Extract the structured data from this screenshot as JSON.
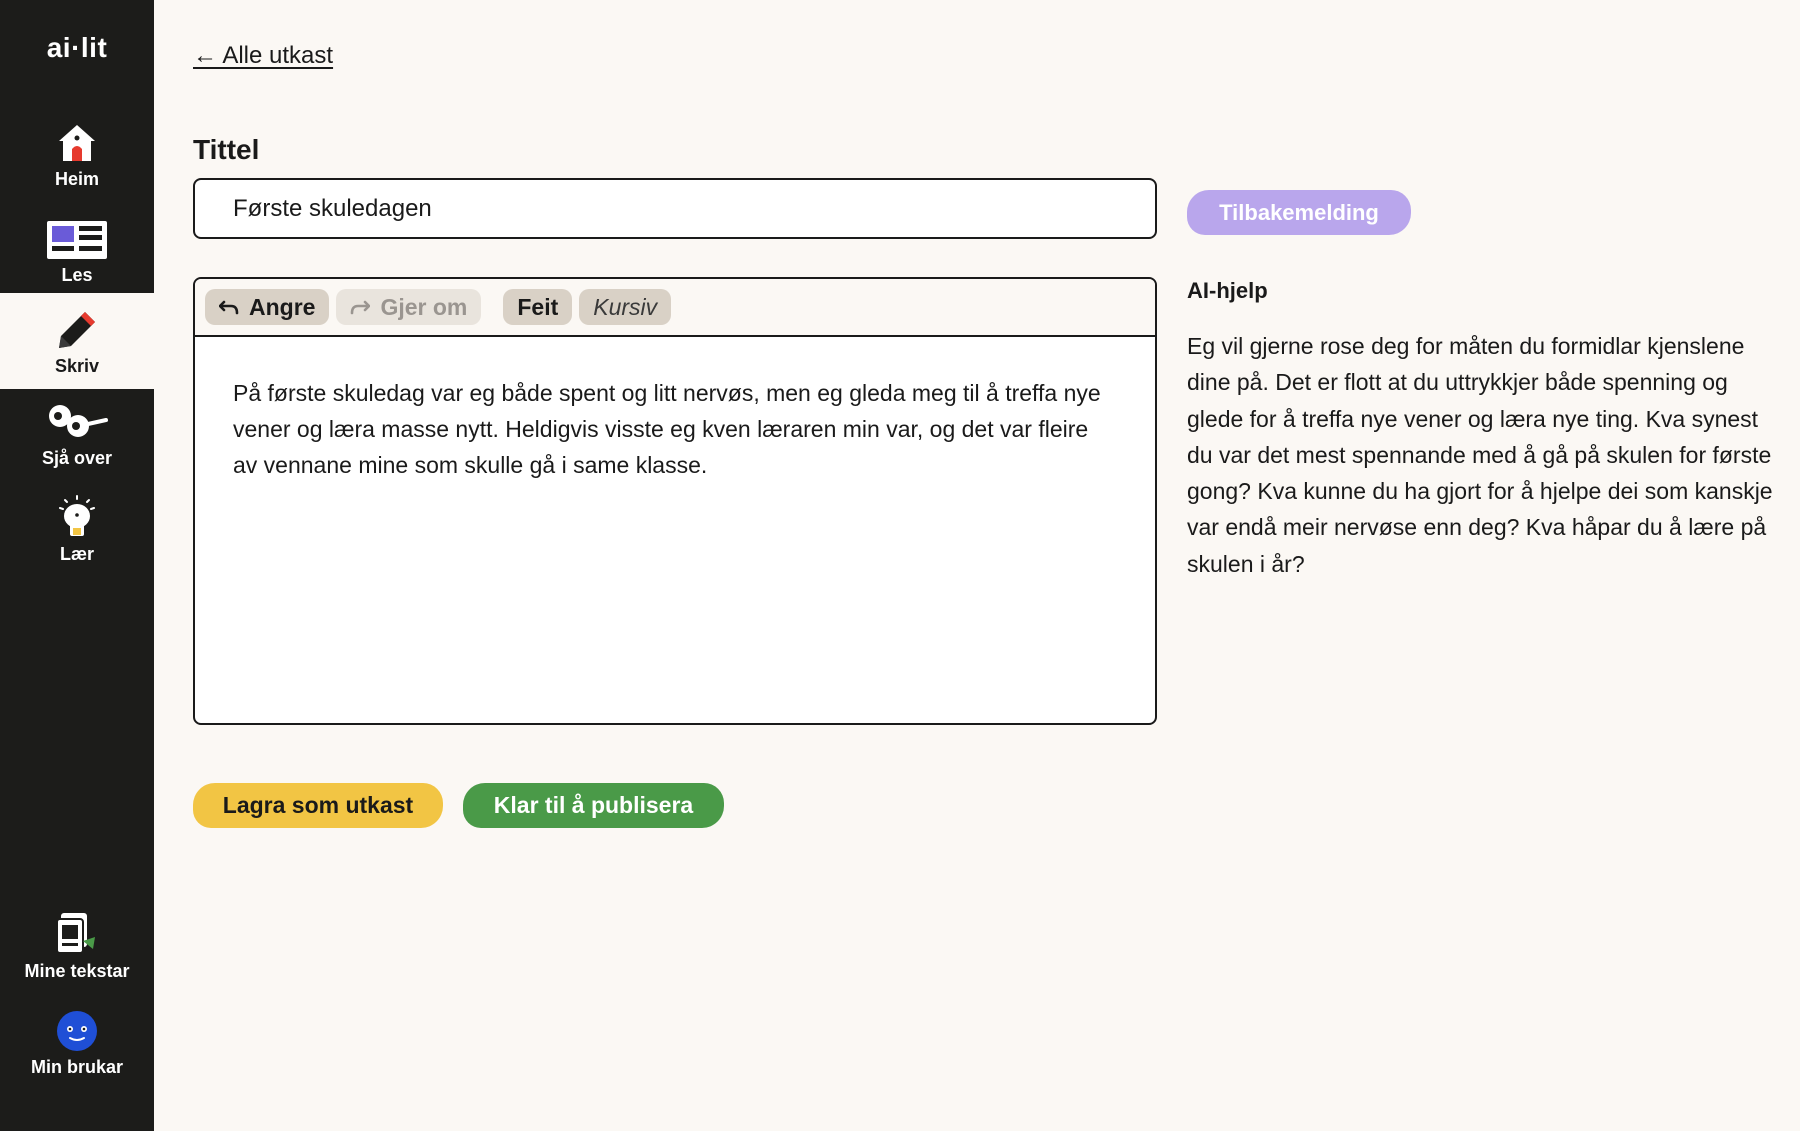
{
  "sidebar": {
    "logo": "ai·lit",
    "items": [
      {
        "label": "Heim",
        "icon": "house-icon"
      },
      {
        "label": "Les",
        "icon": "newspaper-icon"
      },
      {
        "label": "Skriv",
        "icon": "pencil-icon",
        "active": true
      },
      {
        "label": "Sjå over",
        "icon": "review-glasses-icon"
      },
      {
        "label": "Lær",
        "icon": "lightbulb-icon"
      }
    ],
    "bottom_items": [
      {
        "label": "Mine tekstar",
        "icon": "my-texts-icon"
      },
      {
        "label": "Min brukar",
        "icon": "user-avatar-icon"
      }
    ]
  },
  "main": {
    "back_link": "← Alle utkast",
    "title_label": "Tittel",
    "title_value": "Første skuledagen",
    "toolbar": {
      "undo": "Angre",
      "redo": "Gjer om",
      "bold": "Feit",
      "italic": "Kursiv"
    },
    "body_text": "På første skuledag var eg både spent og litt nervøs, men eg gleda meg til å treffa nye vener og læra masse nytt. Heldigvis visste eg kven læraren min var, og det var fleire av vennane mine som skulle gå i same klasse.",
    "save_draft": "Lagra som utkast",
    "publish": "Klar til å publisera"
  },
  "ai_panel": {
    "feedback_button": "Tilbakemelding",
    "title": "AI-hjelp",
    "text": "Eg vil gjerne rose deg for måten du formidlar kjenslene dine på. Det er flott at du uttrykkjer både spenning og glede for å treffa nye vener og læra nye ting. Kva synest du var det mest spennande med å gå på skulen for første gong? Kva kunne du ha gjort for å hjelpe dei som kanskje var endå meir nervøse enn deg? Kva håpar du å lære på skulen i år?"
  },
  "colors": {
    "sidebar_bg": "#1c1c1a",
    "page_bg": "#fbf8f4",
    "feedback": "#b9a6ec",
    "draft": "#f2c544",
    "publish": "#4a9a48"
  }
}
